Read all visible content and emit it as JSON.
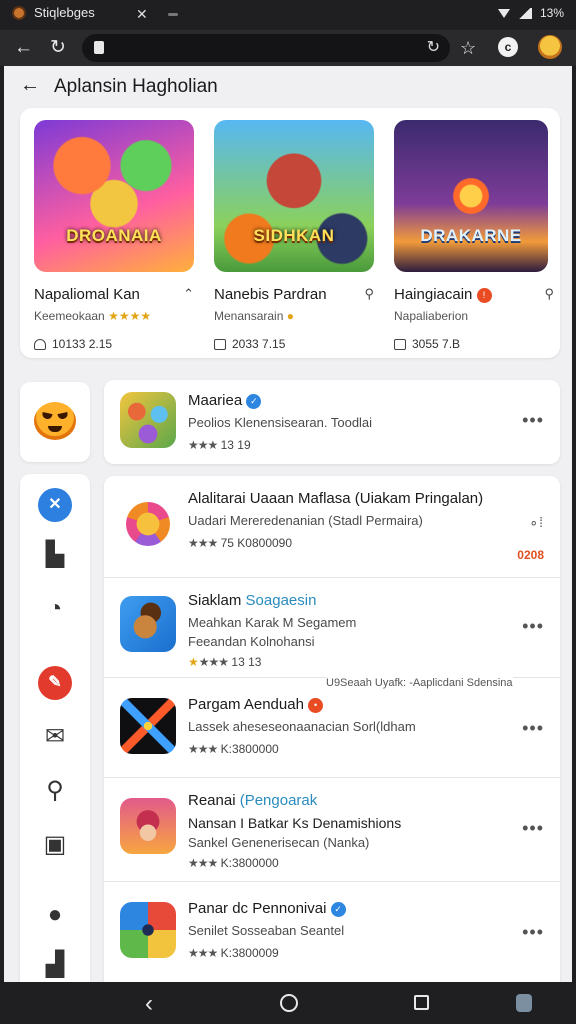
{
  "status_bar": {
    "tab_title": "Stiqlebges",
    "battery": "13%"
  },
  "page": {
    "title": "Aplansin Hagholian"
  },
  "featured": [
    {
      "thumb_title": "DROANAIA",
      "name": "Napaliomal Kan",
      "subtitle": "Keemeokaan",
      "stars": "★★★★",
      "meta": "10133 2.15"
    },
    {
      "thumb_title": "SIDHKAN",
      "name": "Nanebis Pardran",
      "subtitle": "Menansarain",
      "stars": "",
      "meta": "2033 7.15"
    },
    {
      "thumb_title": "DRAKARNE",
      "name": "Haingiacain",
      "subtitle": "Napaliaberion",
      "stars": "",
      "meta": "3055 7.B"
    }
  ],
  "row_card": {
    "name": "Maariea",
    "desc": "Peolios Klenensisearan. Toodlai",
    "rating": "★★★",
    "count": "13 19"
  },
  "apps": [
    {
      "name": "Alalitarai Uaaan Maflasa (Uiakam Pringalan)",
      "tag": "",
      "desc": "Uadari Mereredenanian (Stadl Permaira)",
      "rating": "★★★",
      "count": "75 K0800090",
      "extra": "0208"
    },
    {
      "name": "Siaklam",
      "tag": "Soagaesin",
      "desc": "Meahkan Karak M Segamem",
      "desc2": "Feeandan Kolnohansi",
      "rating": "★★★",
      "count": "13 13"
    },
    {
      "name": "Pargam Aenduah",
      "tag": "",
      "desc": "Lassek aheseseonaanacian Sorl(ldham",
      "rating": "★★★",
      "count": "K:3800000"
    },
    {
      "name": "Reanai",
      "tag": "(Pengoarak",
      "desc": "Nansan I Batkar Ks Denamishions",
      "desc2": "Sankel Genenerisecan (Nanka)",
      "rating": "★★★",
      "count": "K:3800000"
    },
    {
      "name": "Panar dc Pennonivai",
      "tag": "",
      "desc": "Senilet Sosseaban Seantel",
      "rating": "★★★",
      "count": "K:3800009"
    }
  ],
  "floating_note": "U9Seaah Uyafk: -Aaplicdani Sdensina"
}
